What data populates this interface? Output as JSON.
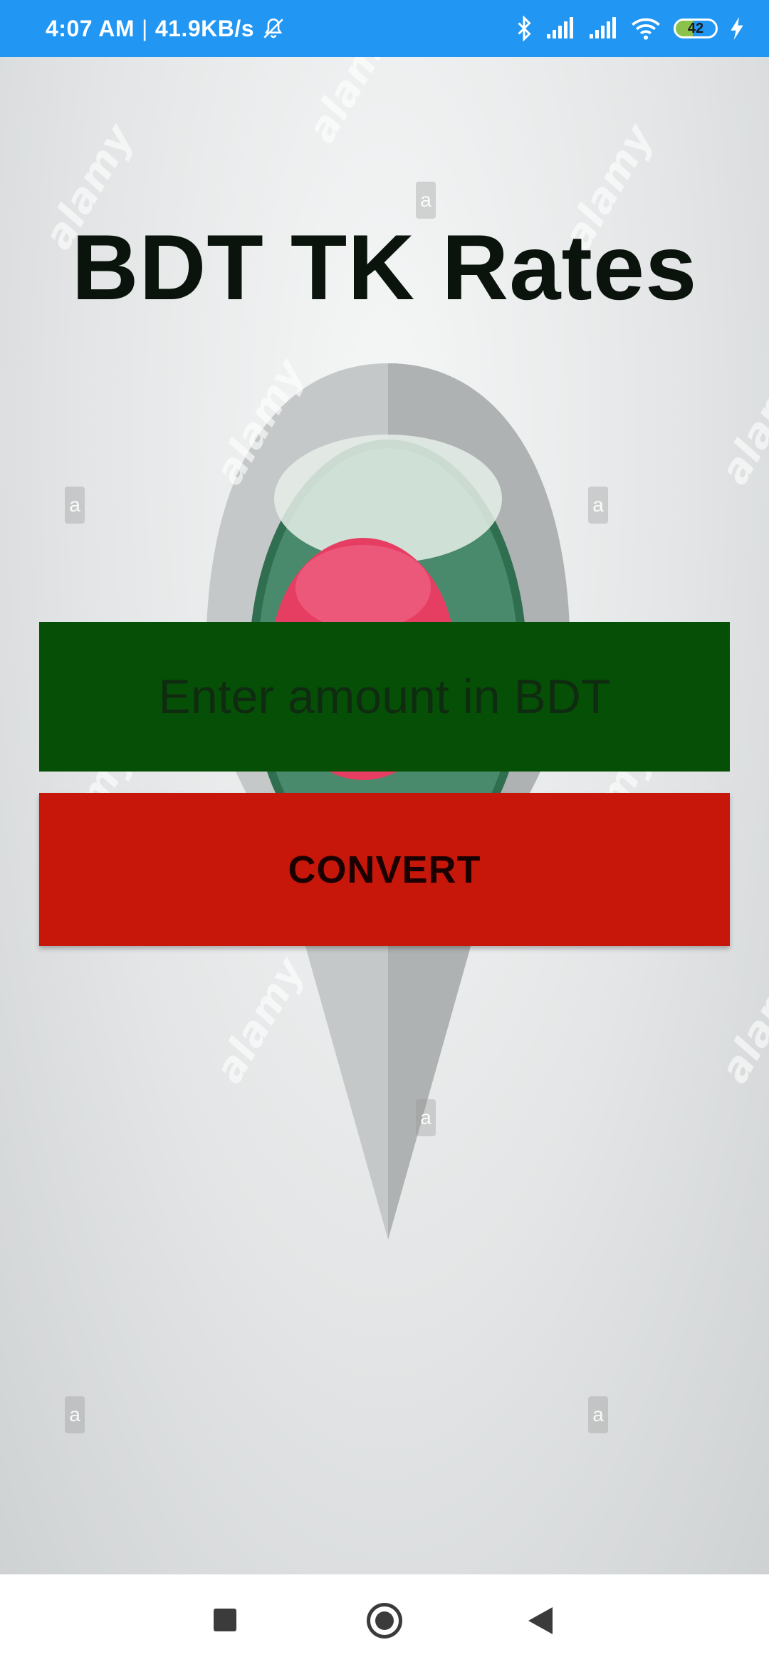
{
  "status_bar": {
    "time": "4:07 AM",
    "separator": "|",
    "speed": "41.9KB/s",
    "battery_level": "42",
    "icons": [
      "bell-off-icon",
      "bluetooth-icon",
      "signal-icon",
      "signal-icon",
      "wifi-icon",
      "battery-icon",
      "charging-icon"
    ],
    "color": "#2196F3"
  },
  "app": {
    "title": "BDT TK Rates",
    "amount_input": {
      "placeholder": "Enter amount in BDT",
      "value": ""
    },
    "convert_label": "CONVERT",
    "colors": {
      "input_bg": "#055006",
      "button_bg": "#C6170A",
      "flag_green": "#2F6E4E",
      "flag_red": "#E63E63"
    }
  },
  "background": {
    "watermark_text": "alamy",
    "watermark_letter": "a"
  },
  "nav_bar": {
    "buttons": [
      "recents-button",
      "home-button",
      "back-button"
    ]
  }
}
